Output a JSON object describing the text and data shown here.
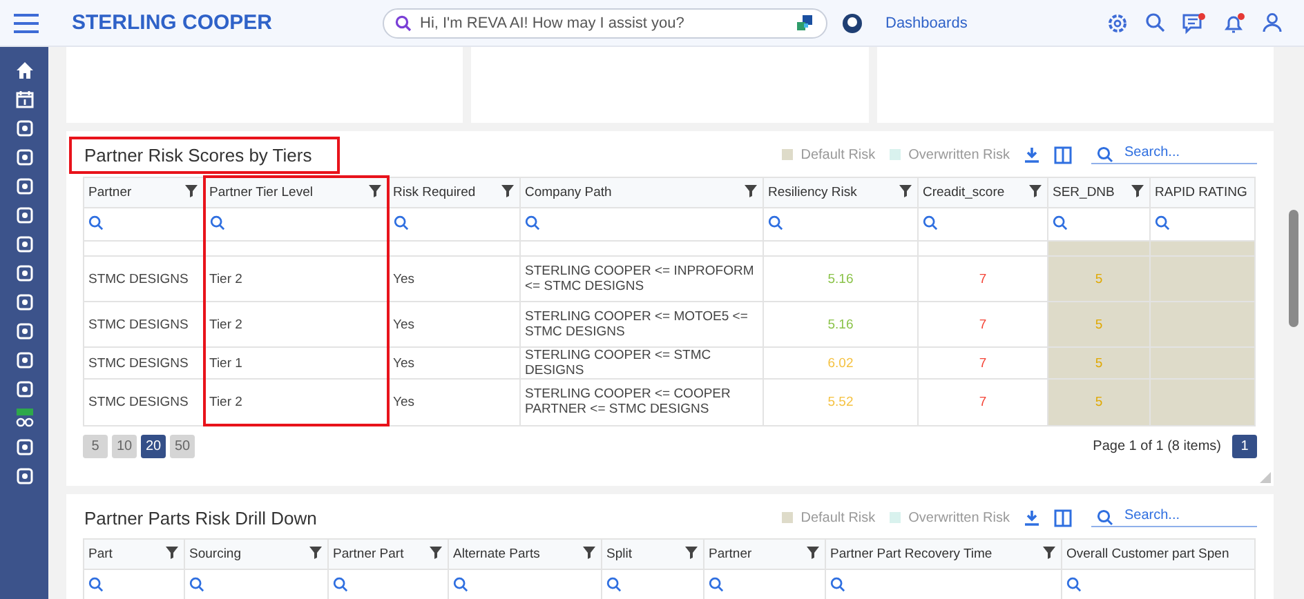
{
  "header": {
    "brand": "STERLING COOPER",
    "search": {
      "placeholder": "Hi, I'm REVA AI! How may I assist you?"
    },
    "dashboards_link": "Dashboards",
    "notifications": [
      {
        "unread": true
      },
      {
        "unread": true
      }
    ]
  },
  "tier_table": {
    "title": "Partner Risk Scores by Tiers",
    "title_highlighted": true,
    "legend": [
      {
        "label": "Default Risk",
        "color": "#dedbc9"
      },
      {
        "label": "Overwritten Risk",
        "color": "#d9f2ee"
      }
    ],
    "search": {
      "placeholder": "Search..."
    },
    "columns": [
      {
        "label": "Partner",
        "highlighted": false,
        "shaded": false
      },
      {
        "label": "Partner Tier Level",
        "highlighted": true,
        "shaded": false
      },
      {
        "label": "Risk Required",
        "highlighted": false,
        "shaded": false
      },
      {
        "label": "Company Path",
        "highlighted": false,
        "shaded": false
      },
      {
        "label": "Resiliency Risk",
        "highlighted": false,
        "shaded": false
      },
      {
        "label": "Creadit_score",
        "highlighted": false,
        "shaded": false
      },
      {
        "label": "SER_DNB",
        "highlighted": false,
        "shaded": true
      },
      {
        "label": "RAPID RATING",
        "highlighted": false,
        "shaded": true
      }
    ],
    "rows": [
      [
        {
          "text": "STMC DESIGNS"
        },
        {
          "text": "Tier 2"
        },
        {
          "text": "Yes"
        },
        {
          "text": "STERLING COOPER <= INPROFORM <= STMC DESIGNS"
        },
        {
          "text": "5.16",
          "color": "#8bc34a"
        },
        {
          "text": "7",
          "color": "#f44336"
        },
        {
          "text": "5",
          "color": "#e0a800"
        },
        {
          "text": ""
        }
      ],
      [
        {
          "text": "STMC DESIGNS"
        },
        {
          "text": "Tier 2"
        },
        {
          "text": "Yes"
        },
        {
          "text": "STERLING COOPER <= MOTOE5 <= STMC DESIGNS"
        },
        {
          "text": "5.16",
          "color": "#8bc34a"
        },
        {
          "text": "7",
          "color": "#f44336"
        },
        {
          "text": "5",
          "color": "#e0a800"
        },
        {
          "text": ""
        }
      ],
      [
        {
          "text": "STMC DESIGNS"
        },
        {
          "text": "Tier 1"
        },
        {
          "text": "Yes"
        },
        {
          "text": "STERLING COOPER <= STMC DESIGNS"
        },
        {
          "text": "6.02",
          "color": "#f5c242"
        },
        {
          "text": "7",
          "color": "#f44336"
        },
        {
          "text": "5",
          "color": "#e0a800"
        },
        {
          "text": ""
        }
      ],
      [
        {
          "text": "STMC DESIGNS"
        },
        {
          "text": "Tier 2"
        },
        {
          "text": "Yes"
        },
        {
          "text": "STERLING COOPER <= COOPER PARTNER <= STMC DESIGNS"
        },
        {
          "text": "5.52",
          "color": "#f5c242"
        },
        {
          "text": "7",
          "color": "#f44336"
        },
        {
          "text": "5",
          "color": "#e0a800"
        },
        {
          "text": ""
        }
      ]
    ],
    "page_sizes": [
      {
        "label": "5",
        "selected": false
      },
      {
        "label": "10",
        "selected": false
      },
      {
        "label": "20",
        "selected": true
      },
      {
        "label": "50",
        "selected": false
      }
    ],
    "page_info": "Page 1 of 1 (8 items)",
    "pages": [
      {
        "label": "1",
        "selected": true
      }
    ]
  },
  "parts_table": {
    "title": "Partner Parts Risk Drill Down",
    "legend": [
      {
        "label": "Default Risk",
        "color": "#dedbc9"
      },
      {
        "label": "Overwritten Risk",
        "color": "#d9f2ee"
      }
    ],
    "search": {
      "placeholder": "Search..."
    },
    "columns": [
      {
        "label": "Part",
        "filter": true
      },
      {
        "label": "Sourcing",
        "filter": true
      },
      {
        "label": "Partner Part",
        "filter": true
      },
      {
        "label": "Alternate Parts",
        "filter": true
      },
      {
        "label": "Split",
        "filter": true
      },
      {
        "label": "Partner",
        "filter": true
      },
      {
        "label": "Partner Part Recovery Time",
        "filter": true
      },
      {
        "label": "Overall Customer part Spen",
        "filter": false
      }
    ]
  }
}
